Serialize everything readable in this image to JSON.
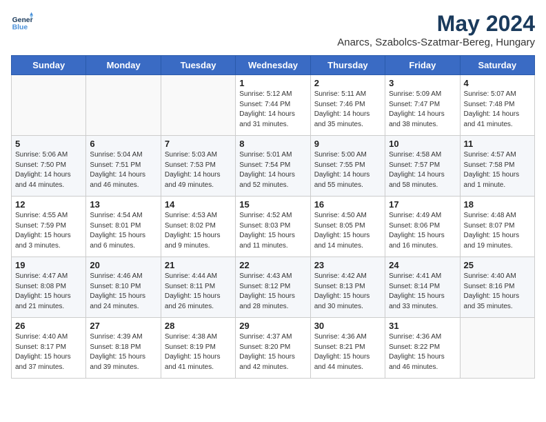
{
  "header": {
    "logo_line1": "General",
    "logo_line2": "Blue",
    "month_title": "May 2024",
    "subtitle": "Anarcs, Szabolcs-Szatmar-Bereg, Hungary"
  },
  "days_of_week": [
    "Sunday",
    "Monday",
    "Tuesday",
    "Wednesday",
    "Thursday",
    "Friday",
    "Saturday"
  ],
  "weeks": [
    [
      {
        "day": "",
        "info": ""
      },
      {
        "day": "",
        "info": ""
      },
      {
        "day": "",
        "info": ""
      },
      {
        "day": "1",
        "info": "Sunrise: 5:12 AM\nSunset: 7:44 PM\nDaylight: 14 hours\nand 31 minutes."
      },
      {
        "day": "2",
        "info": "Sunrise: 5:11 AM\nSunset: 7:46 PM\nDaylight: 14 hours\nand 35 minutes."
      },
      {
        "day": "3",
        "info": "Sunrise: 5:09 AM\nSunset: 7:47 PM\nDaylight: 14 hours\nand 38 minutes."
      },
      {
        "day": "4",
        "info": "Sunrise: 5:07 AM\nSunset: 7:48 PM\nDaylight: 14 hours\nand 41 minutes."
      }
    ],
    [
      {
        "day": "5",
        "info": "Sunrise: 5:06 AM\nSunset: 7:50 PM\nDaylight: 14 hours\nand 44 minutes."
      },
      {
        "day": "6",
        "info": "Sunrise: 5:04 AM\nSunset: 7:51 PM\nDaylight: 14 hours\nand 46 minutes."
      },
      {
        "day": "7",
        "info": "Sunrise: 5:03 AM\nSunset: 7:53 PM\nDaylight: 14 hours\nand 49 minutes."
      },
      {
        "day": "8",
        "info": "Sunrise: 5:01 AM\nSunset: 7:54 PM\nDaylight: 14 hours\nand 52 minutes."
      },
      {
        "day": "9",
        "info": "Sunrise: 5:00 AM\nSunset: 7:55 PM\nDaylight: 14 hours\nand 55 minutes."
      },
      {
        "day": "10",
        "info": "Sunrise: 4:58 AM\nSunset: 7:57 PM\nDaylight: 14 hours\nand 58 minutes."
      },
      {
        "day": "11",
        "info": "Sunrise: 4:57 AM\nSunset: 7:58 PM\nDaylight: 15 hours\nand 1 minute."
      }
    ],
    [
      {
        "day": "12",
        "info": "Sunrise: 4:55 AM\nSunset: 7:59 PM\nDaylight: 15 hours\nand 3 minutes."
      },
      {
        "day": "13",
        "info": "Sunrise: 4:54 AM\nSunset: 8:01 PM\nDaylight: 15 hours\nand 6 minutes."
      },
      {
        "day": "14",
        "info": "Sunrise: 4:53 AM\nSunset: 8:02 PM\nDaylight: 15 hours\nand 9 minutes."
      },
      {
        "day": "15",
        "info": "Sunrise: 4:52 AM\nSunset: 8:03 PM\nDaylight: 15 hours\nand 11 minutes."
      },
      {
        "day": "16",
        "info": "Sunrise: 4:50 AM\nSunset: 8:05 PM\nDaylight: 15 hours\nand 14 minutes."
      },
      {
        "day": "17",
        "info": "Sunrise: 4:49 AM\nSunset: 8:06 PM\nDaylight: 15 hours\nand 16 minutes."
      },
      {
        "day": "18",
        "info": "Sunrise: 4:48 AM\nSunset: 8:07 PM\nDaylight: 15 hours\nand 19 minutes."
      }
    ],
    [
      {
        "day": "19",
        "info": "Sunrise: 4:47 AM\nSunset: 8:08 PM\nDaylight: 15 hours\nand 21 minutes."
      },
      {
        "day": "20",
        "info": "Sunrise: 4:46 AM\nSunset: 8:10 PM\nDaylight: 15 hours\nand 24 minutes."
      },
      {
        "day": "21",
        "info": "Sunrise: 4:44 AM\nSunset: 8:11 PM\nDaylight: 15 hours\nand 26 minutes."
      },
      {
        "day": "22",
        "info": "Sunrise: 4:43 AM\nSunset: 8:12 PM\nDaylight: 15 hours\nand 28 minutes."
      },
      {
        "day": "23",
        "info": "Sunrise: 4:42 AM\nSunset: 8:13 PM\nDaylight: 15 hours\nand 30 minutes."
      },
      {
        "day": "24",
        "info": "Sunrise: 4:41 AM\nSunset: 8:14 PM\nDaylight: 15 hours\nand 33 minutes."
      },
      {
        "day": "25",
        "info": "Sunrise: 4:40 AM\nSunset: 8:16 PM\nDaylight: 15 hours\nand 35 minutes."
      }
    ],
    [
      {
        "day": "26",
        "info": "Sunrise: 4:40 AM\nSunset: 8:17 PM\nDaylight: 15 hours\nand 37 minutes."
      },
      {
        "day": "27",
        "info": "Sunrise: 4:39 AM\nSunset: 8:18 PM\nDaylight: 15 hours\nand 39 minutes."
      },
      {
        "day": "28",
        "info": "Sunrise: 4:38 AM\nSunset: 8:19 PM\nDaylight: 15 hours\nand 41 minutes."
      },
      {
        "day": "29",
        "info": "Sunrise: 4:37 AM\nSunset: 8:20 PM\nDaylight: 15 hours\nand 42 minutes."
      },
      {
        "day": "30",
        "info": "Sunrise: 4:36 AM\nSunset: 8:21 PM\nDaylight: 15 hours\nand 44 minutes."
      },
      {
        "day": "31",
        "info": "Sunrise: 4:36 AM\nSunset: 8:22 PM\nDaylight: 15 hours\nand 46 minutes."
      },
      {
        "day": "",
        "info": ""
      }
    ]
  ]
}
